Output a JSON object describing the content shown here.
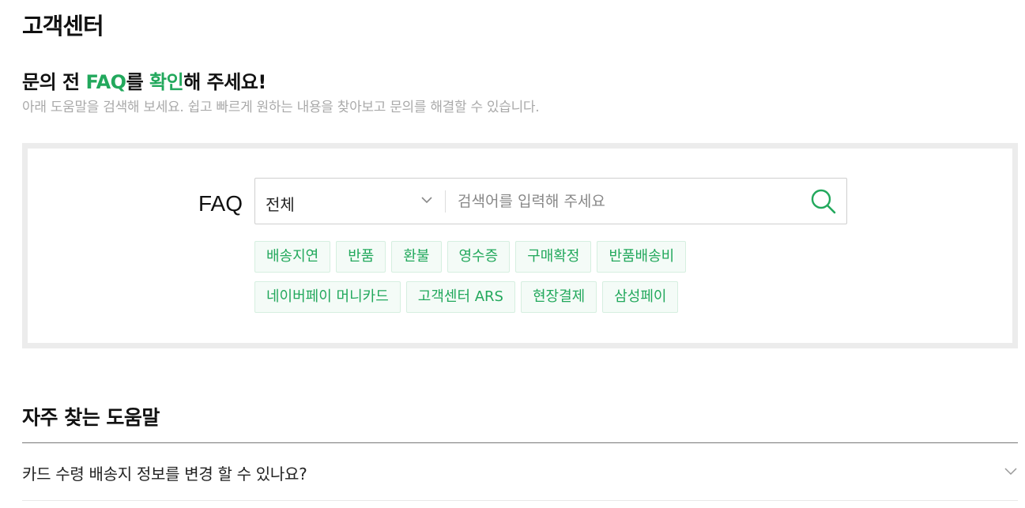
{
  "page": {
    "title": "고객센터"
  },
  "intro": {
    "headline_pre": "문의 전 ",
    "headline_accent1": "FAQ",
    "headline_mid": "를 ",
    "headline_accent2": "확인",
    "headline_post": "해 주세요!",
    "subtext": "아래 도움말을 검색해 보세요. 쉽고 빠르게 원하는 내용을 찾아보고 문의를 해결할 수 있습니다."
  },
  "search": {
    "label": "FAQ",
    "category_selected": "전체",
    "placeholder": "검색어를 입력해 주세요",
    "value": "",
    "icons": {
      "dropdown": "chevron-down-icon",
      "submit": "search-icon"
    }
  },
  "quick_tags": [
    [
      "배송지연",
      "반품",
      "환불",
      "영수증",
      "구매확정",
      "반품배송비"
    ],
    [
      "네이버페이 머니카드",
      "고객센터 ARS",
      "현장결제",
      "삼성페이"
    ]
  ],
  "faq": {
    "section_title": "자주 찾는 도움말",
    "items": [
      {
        "question": "카드 수령 배송지 정보를 변경 할 수 있나요?"
      }
    ]
  },
  "colors": {
    "accent": "#22a85c",
    "tag_bg": "#f4fbf7",
    "tag_border": "#d6efe0",
    "box_border": "#ececec"
  }
}
